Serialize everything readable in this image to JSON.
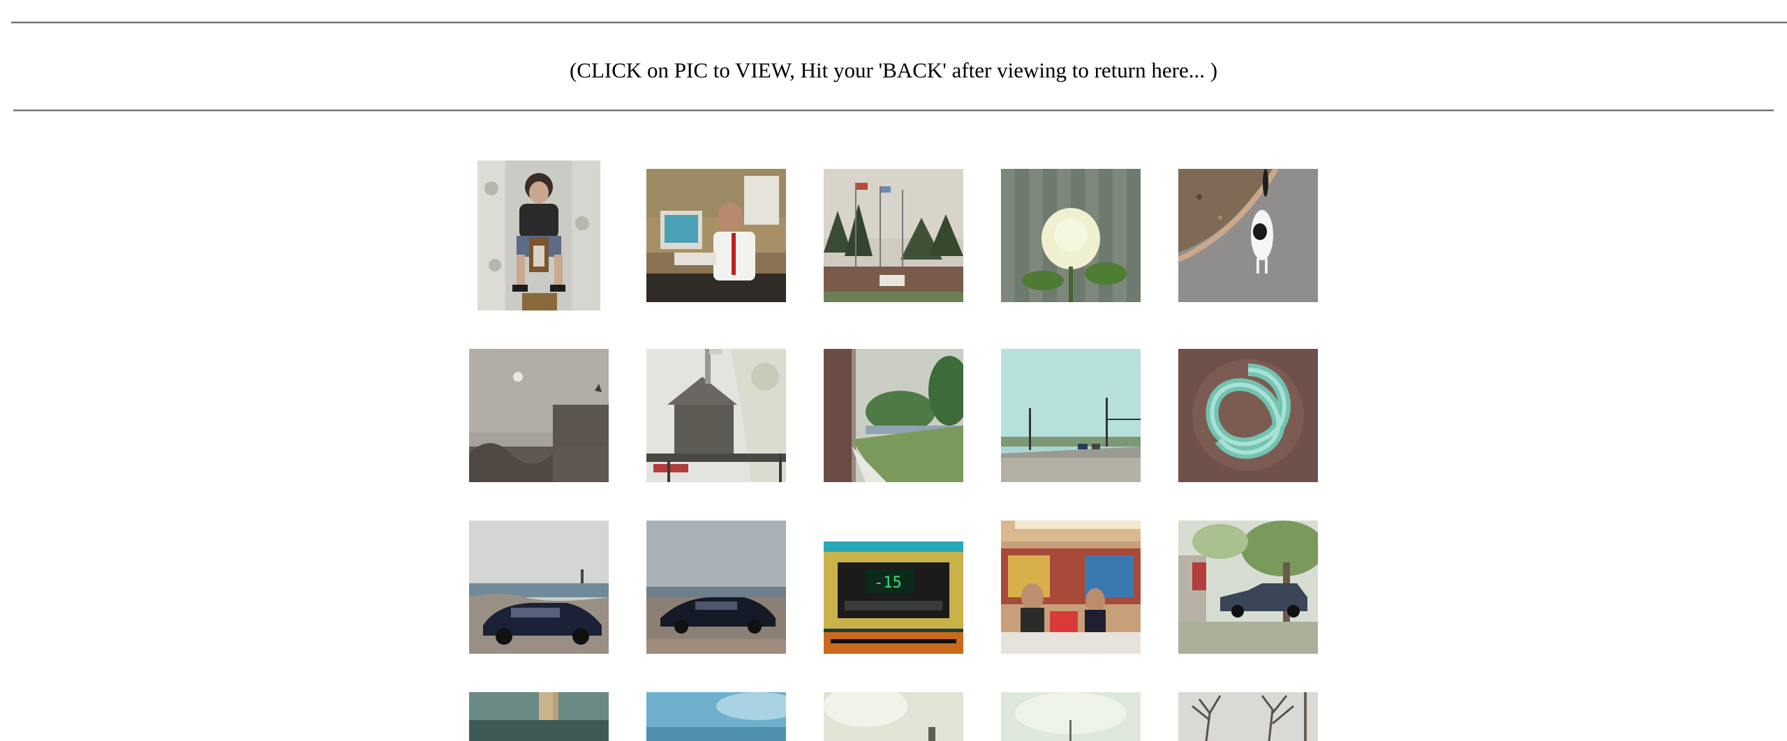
{
  "instructions": "(CLICK on PIC to VIEW, Hit your 'BACK' after viewing to return here... )",
  "gallery": {
    "rows": [
      [
        "thumbnail-person-on-chair",
        "thumbnail-man-at-desk",
        "thumbnail-flagpoles",
        "thumbnail-white-rose",
        "thumbnail-cat-on-path"
      ],
      [
        "thumbnail-hazy-sky",
        "thumbnail-birdhouse",
        "thumbnail-lawn-view",
        "thumbnail-road-intersection",
        "thumbnail-knot-sculpture"
      ],
      [
        "thumbnail-car-by-water",
        "thumbnail-dark-sedan",
        "thumbnail-car-radio",
        "thumbnail-store-counter",
        "thumbnail-pickup-truck"
      ],
      [
        "thumbnail-tower",
        "thumbnail-blue-sky",
        "thumbnail-bright-sky",
        "thumbnail-horizon",
        "thumbnail-bare-trees"
      ]
    ]
  },
  "colors": {
    "rule": "#6e6e6e",
    "text": "#000000",
    "background": "#ffffff"
  }
}
